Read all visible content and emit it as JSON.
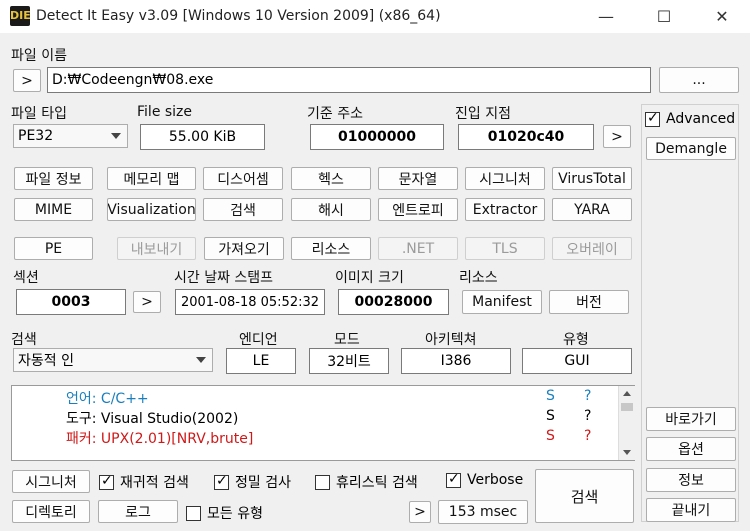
{
  "window": {
    "title": "Detect It Easy v3.09 [Windows 10 Version 2009] (x86_64)",
    "icon": "DIE",
    "minimize": "—",
    "maximize": "☐",
    "close": "✕"
  },
  "file": {
    "label": "파일 이름",
    "arrow": ">",
    "path": "D:₩Codeengn₩08.exe",
    "browse": "..."
  },
  "info": {
    "type_label": "파일 타입",
    "type_value": "PE32",
    "size_label": "File size",
    "size_value": "55.00 KiB",
    "base_label": "기준 주소",
    "base_value": "01000000",
    "entry_label": "진입 지점",
    "entry_value": "01020c40",
    "entry_arrow": ">"
  },
  "advanced": {
    "label": "Advanced",
    "checked": true,
    "demangle": "Demangle"
  },
  "tools_row1": [
    "파일 정보",
    "메모리 맵",
    "디스어셈",
    "헥스",
    "문자열",
    "시그니처",
    "VirusTotal"
  ],
  "tools_row2": [
    "MIME",
    "Visualization",
    "검색",
    "해시",
    "엔트로피",
    "Extractor",
    "YARA"
  ],
  "pe_row": [
    {
      "label": "PE",
      "enabled": true
    },
    {
      "label": "내보내기",
      "enabled": false
    },
    {
      "label": "가져오기",
      "enabled": true
    },
    {
      "label": "리소스",
      "enabled": true
    },
    {
      "label": ".NET",
      "enabled": false
    },
    {
      "label": "TLS",
      "enabled": false
    },
    {
      "label": "오버레이",
      "enabled": false
    }
  ],
  "section": {
    "label": "섹션",
    "value": "0003",
    "arrow": ">"
  },
  "timestamp": {
    "label": "시간 날짜 스탬프",
    "value": "2001-08-18 05:52:32"
  },
  "image": {
    "label": "이미지 크기",
    "value": "00028000"
  },
  "resources": {
    "label": "리소스",
    "manifest": "Manifest",
    "version": "버전"
  },
  "scan": {
    "label": "검색",
    "mode_value": "자동적 인"
  },
  "endian": {
    "label": "엔디언",
    "value": "LE"
  },
  "mode": {
    "label": "모드",
    "value": "32비트"
  },
  "arch": {
    "label": "아키텍쳐",
    "value": "I386"
  },
  "type": {
    "label": "유형",
    "value": "GUI"
  },
  "results": [
    {
      "text": "언어: C/C++",
      "s": "S",
      "q": "?",
      "color": "#1a7fbf"
    },
    {
      "text": "도구: Visual Studio(2002)",
      "s": "S",
      "q": "?",
      "color": "#000000"
    },
    {
      "text": "패커: UPX(2.01)[NRV,brute]",
      "s": "S",
      "q": "?",
      "color": "#d01818"
    }
  ],
  "bottom": {
    "signature": "시그니처",
    "recursive": "재귀적 검색",
    "deep": "정밀 검사",
    "heuristic": "휴리스틱 검색",
    "verbose": "Verbose",
    "directory": "디렉토리",
    "log": "로그",
    "all_types": "모든 유형",
    "arrow": ">",
    "time": "153 msec",
    "scan": "검색"
  },
  "side": {
    "goto": "바로가기",
    "options": "옵션",
    "about": "정보",
    "exit": "끝내기"
  }
}
